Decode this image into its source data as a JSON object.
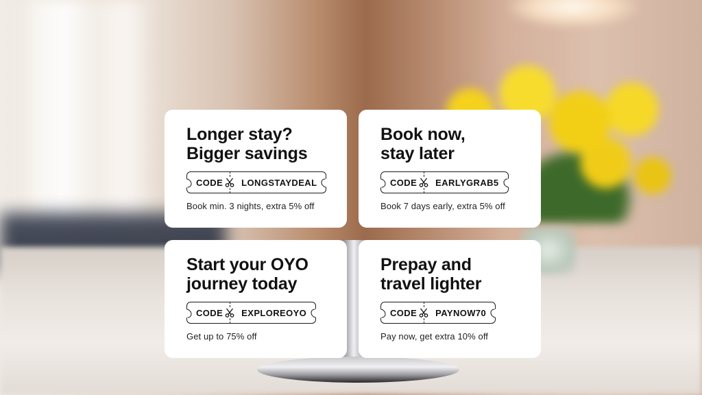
{
  "colors": {
    "card_bg": "#ffffff",
    "text": "#111111",
    "flower_yellow": "#f4d21c"
  },
  "offers": [
    {
      "title_line1": "Longer stay?",
      "title_line2": "Bigger savings",
      "code_label": "CODE",
      "code": "LONGSTAYDEAL",
      "icon": "scissors-icon",
      "description": "Book min. 3 nights, extra 5% off"
    },
    {
      "title_line1": "Book now,",
      "title_line2": "stay later",
      "code_label": "CODE",
      "code": "EARLYGRAB5",
      "icon": "scissors-icon",
      "description": "Book 7 days early, extra 5% off"
    },
    {
      "title_line1": "Start your OYO",
      "title_line2": "journey today",
      "code_label": "CODE",
      "code": "EXPLOREOYO",
      "icon": "scissors-icon",
      "description": "Get up to 75% off"
    },
    {
      "title_line1": "Prepay and",
      "title_line2": "travel lighter",
      "code_label": "CODE",
      "code": "PAYNOW70",
      "icon": "scissors-icon",
      "description": "Pay now, get extra 10% off"
    }
  ]
}
